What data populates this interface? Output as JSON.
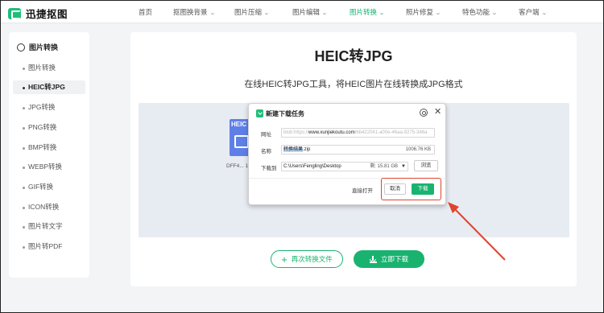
{
  "header": {
    "logo_text": "迅捷抠图",
    "nav": [
      {
        "label": "首页",
        "dropdown": false
      },
      {
        "label": "抠图换背景",
        "dropdown": true
      },
      {
        "label": "图片压缩",
        "dropdown": true
      },
      {
        "label": "图片编辑",
        "dropdown": true
      },
      {
        "label": "图片转换",
        "dropdown": true,
        "active": true
      },
      {
        "label": "照片修复",
        "dropdown": true
      },
      {
        "label": "特色功能",
        "dropdown": true
      },
      {
        "label": "客户端",
        "dropdown": true
      }
    ]
  },
  "sidebar": {
    "heading": "图片转换",
    "items": [
      {
        "label": "图片转换"
      },
      {
        "label": "HEIC转JPG",
        "active": true
      },
      {
        "label": "JPG转换"
      },
      {
        "label": "PNG转换"
      },
      {
        "label": "BMP转换"
      },
      {
        "label": "WEBP转换"
      },
      {
        "label": "GIF转换"
      },
      {
        "label": "ICON转换"
      },
      {
        "label": "图片转文字"
      },
      {
        "label": "图片转PDF"
      }
    ]
  },
  "main": {
    "title": "HEIC转JPG",
    "subtitle": "在线HEIC转JPG工具，将HEIC图片在线转换成JPG格式",
    "file": {
      "badge": "HEIC",
      "name": "DFF4...  10"
    },
    "again_button": "再次转换文件",
    "download_button": "立即下载"
  },
  "dialog": {
    "title": "新建下载任务",
    "url_label": "网址",
    "url_prefix": "blob:https://",
    "url_host": "www.xunjiekoutu.com",
    "url_suffix": "/6b422041-a00e-46aa-9275-346a",
    "name_label": "名称",
    "name_selected": "转换结果",
    "name_ext": ".zip",
    "file_size": "1006.76 KB",
    "save_label": "下载到",
    "save_path": "C:\\Users\\Fengling\\Desktop",
    "free_space": "剩: 15.81 GB",
    "browse_button": "浏览",
    "open_direct": "直接打开",
    "cancel_button": "取消",
    "download_button": "下载"
  },
  "colors": {
    "accent": "#19b36f",
    "highlight": "#e0442c",
    "file_thumb": "#5f7fe8"
  }
}
